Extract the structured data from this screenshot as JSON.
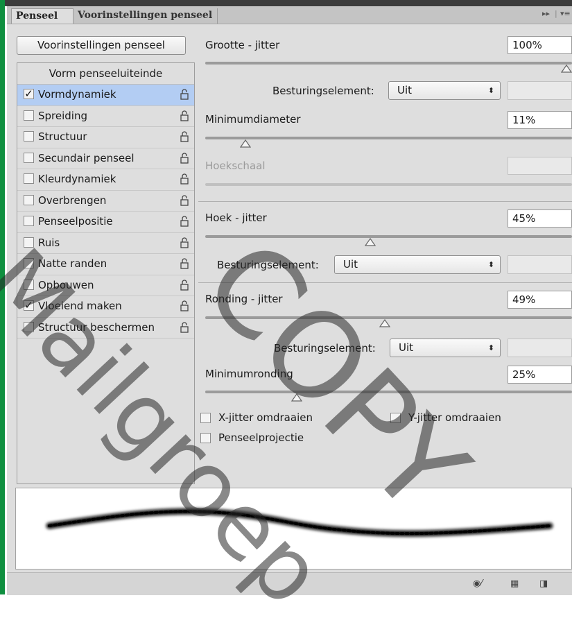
{
  "tabs": {
    "active": "Penseel",
    "inactive": "Voorinstellingen penseel",
    "expand_icon": "double-arrow-icon",
    "menu_icon": "panel-menu-icon"
  },
  "presets_button": "Voorinstellingen penseel",
  "sidebar": {
    "header": "Vorm penseeluiteinde",
    "items": [
      {
        "label": "Vormdynamiek",
        "checked": true,
        "selected": true
      },
      {
        "label": "Spreiding",
        "checked": false
      },
      {
        "label": "Structuur",
        "checked": false
      },
      {
        "label": "Secundair penseel",
        "checked": false
      },
      {
        "label": "Kleurdynamiek",
        "checked": false
      },
      {
        "label": "Overbrengen",
        "checked": false
      },
      {
        "label": "Penseelpositie",
        "checked": false
      },
      {
        "label": "Ruis",
        "checked": false
      },
      {
        "label": "Natte randen",
        "checked": false
      },
      {
        "label": "Opbouwen",
        "checked": false
      },
      {
        "label": "Vloeiend maken",
        "checked": true
      },
      {
        "label": "Structuur beschermen",
        "checked": false
      }
    ]
  },
  "settings": {
    "size_jitter": {
      "label": "Grootte - jitter",
      "value": "100%",
      "level": 1.0
    },
    "size_control": {
      "label": "Besturingselement:",
      "value": "Uit"
    },
    "min_diameter": {
      "label": "Minimumdiameter",
      "value": "11%",
      "level": 0.11
    },
    "tilt_scale": {
      "label": "Hoekschaal",
      "value": ""
    },
    "angle_jitter": {
      "label": "Hoek - jitter",
      "value": "45%",
      "level": 0.45
    },
    "angle_control": {
      "label": "Besturingselement:",
      "value": "Uit"
    },
    "roundness_jitter": {
      "label": "Ronding - jitter",
      "value": "49%",
      "level": 0.49
    },
    "roundness_control": {
      "label": "Besturingselement:",
      "value": "Uit"
    },
    "min_roundness": {
      "label": "Minimumronding",
      "value": "25%",
      "level": 0.25
    },
    "flip_x": {
      "label": "X-jitter omdraaien",
      "checked": false
    },
    "flip_y": {
      "label": "Y-jitter omdraaien",
      "checked": false
    },
    "brush_projection": {
      "label": "Penseelprojectie",
      "checked": false
    }
  },
  "status_icons": [
    "eye-brush-icon",
    "grid-panel-icon",
    "new-preset-icon"
  ],
  "watermark": {
    "line1": "Mailgroep",
    "line2": "COPY"
  }
}
